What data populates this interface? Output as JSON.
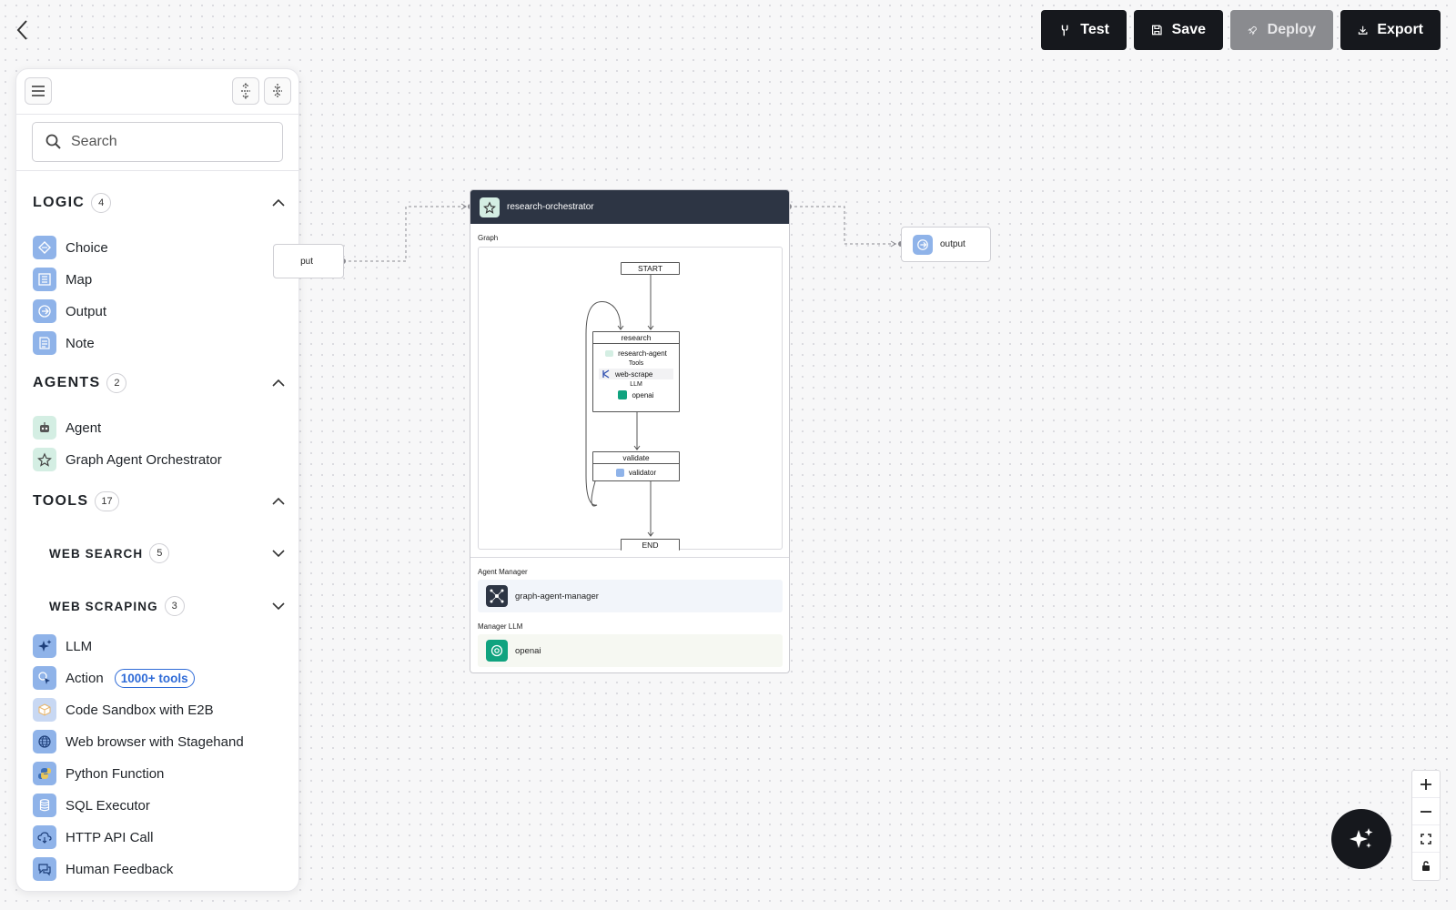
{
  "toolbar": {
    "test_label": "Test",
    "save_label": "Save",
    "deploy_label": "Deploy",
    "export_label": "Export"
  },
  "sidebar": {
    "search_placeholder": "Search",
    "logic": {
      "title": "LOGIC",
      "count": "4",
      "items": [
        {
          "label": "Choice",
          "icon": "choice-icon"
        },
        {
          "label": "Map",
          "icon": "map-icon"
        },
        {
          "label": "Output",
          "icon": "output-icon"
        },
        {
          "label": "Note",
          "icon": "note-icon"
        }
      ]
    },
    "agents": {
      "title": "AGENTS",
      "count": "2",
      "items": [
        {
          "label": "Agent",
          "icon": "robot-icon"
        },
        {
          "label": "Graph Agent Orchestrator",
          "icon": "star-icon"
        }
      ]
    },
    "tools": {
      "title": "TOOLS",
      "count": "17",
      "web_search": {
        "title": "WEB SEARCH",
        "count": "5"
      },
      "web_scraping": {
        "title": "WEB SCRAPING",
        "count": "3"
      },
      "items": [
        {
          "label": "LLM",
          "icon": "sparkle-icon"
        },
        {
          "label": "Action",
          "icon": "cursor-icon",
          "pill": "1000+ tools"
        },
        {
          "label": "Code Sandbox with E2B",
          "icon": "cube-icon"
        },
        {
          "label": "Web browser with Stagehand",
          "icon": "globe-icon"
        },
        {
          "label": "Python Function",
          "icon": "python-icon"
        },
        {
          "label": "SQL Executor",
          "icon": "database-icon"
        },
        {
          "label": "HTTP API Call",
          "icon": "cloud-icon"
        },
        {
          "label": "Human Feedback",
          "icon": "chat-icon"
        }
      ]
    }
  },
  "canvas": {
    "input_node_label": "put",
    "output_node_label": "output",
    "orchestrator": {
      "title": "research-orchestrator",
      "graph_label": "Graph",
      "start": "START",
      "end": "END",
      "research": {
        "title": "research",
        "agent": "research-agent",
        "tools_label": "Tools",
        "tool": "web-scrape",
        "llm_label": "LLM",
        "llm": "openai"
      },
      "validate": {
        "title": "validate",
        "agent": "validator"
      },
      "agent_manager_label": "Agent Manager",
      "agent_manager": "graph-agent-manager",
      "manager_llm_label": "Manager LLM",
      "manager_llm": "openai"
    }
  },
  "colors": {
    "button_dark": "#16181d",
    "button_disabled": "#8a8b8f",
    "node_header": "#2d3544",
    "accent_blue": "#2f6bd7",
    "openai_green": "#10a37f"
  }
}
